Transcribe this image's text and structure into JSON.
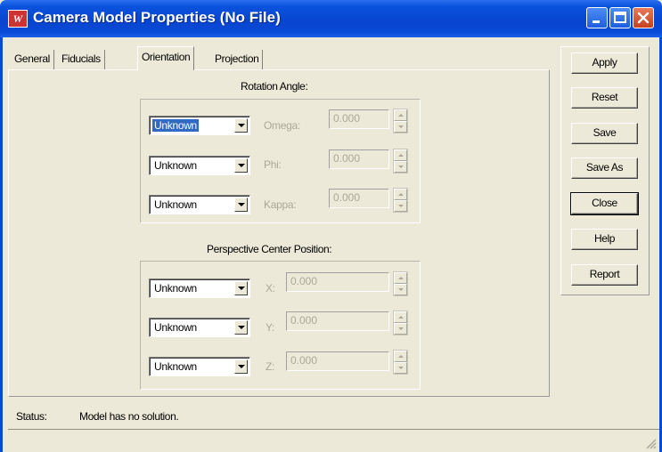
{
  "window": {
    "title": "Camera Model Properties (No File)",
    "icon": "camera-model-app-icon",
    "titlebar_color": "#0a4ad6"
  },
  "tabs": [
    {
      "label": "General",
      "active": false
    },
    {
      "label": "Fiducials",
      "active": false
    },
    {
      "label": "Orientation",
      "active": true
    },
    {
      "label": "Projection",
      "active": false
    }
  ],
  "rotation": {
    "title": "Rotation Angle:",
    "rows": [
      {
        "label": "Omega:",
        "value": "0.000",
        "selection": "Unknown",
        "selected": true
      },
      {
        "label": "Phi:",
        "value": "0.000",
        "selection": "Unknown",
        "selected": false
      },
      {
        "label": "Kappa:",
        "value": "0.000",
        "selection": "Unknown",
        "selected": false
      }
    ]
  },
  "perspective": {
    "title": "Perspective Center Position:",
    "rows": [
      {
        "label": "X:",
        "value": "0.000",
        "selection": "Unknown"
      },
      {
        "label": "Y:",
        "value": "0.000",
        "selection": "Unknown"
      },
      {
        "label": "Z:",
        "value": "0.000",
        "selection": "Unknown"
      }
    ]
  },
  "buttons": {
    "apply": "Apply",
    "reset": "Reset",
    "save": "Save",
    "save_as": "Save As",
    "close": "Close",
    "help": "Help",
    "report": "Report"
  },
  "status": {
    "label": "Status:",
    "text": "Model has no solution."
  },
  "colors": {
    "selection_highlight": "#316ac5",
    "disabled_text": "#aca899",
    "dialog_background": "#ece9d8"
  }
}
